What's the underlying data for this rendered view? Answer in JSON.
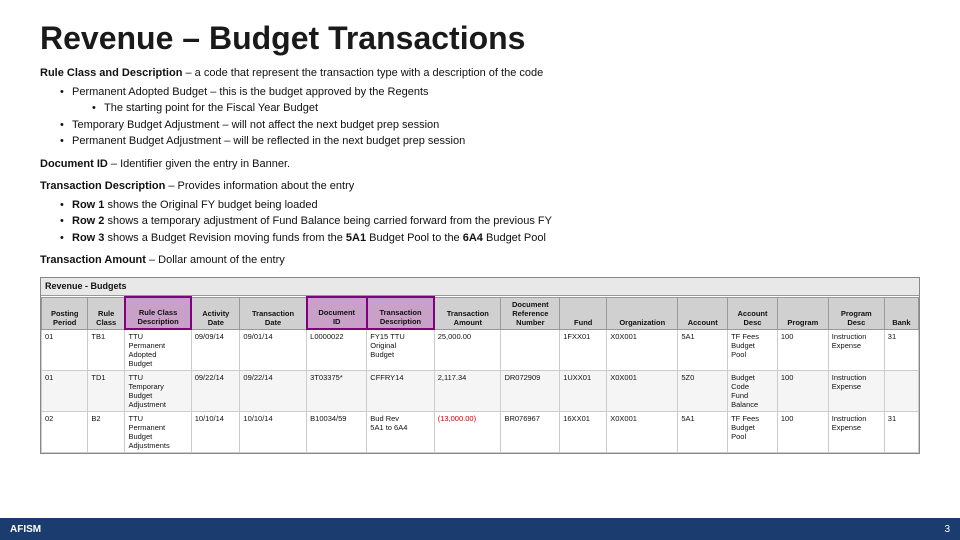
{
  "title": "Revenue – Budget Transactions",
  "sections": [
    {
      "label": "Rule Class and Description",
      "text": " – a code that represent the transaction type with a description of the code",
      "bullets": [
        {
          "text": "Permanent Adopted Budget – this is the budget approved by the Regents",
          "sub": [
            "The starting point for the Fiscal Year Budget"
          ]
        },
        {
          "text": "Temporary Budget Adjustment – will not affect the next budget prep session",
          "sub": []
        },
        {
          "text": "Permanent Budget Adjustment – will be reflected in the next budget prep session",
          "sub": []
        }
      ]
    },
    {
      "label": "Document ID",
      "text": " – Identifier given the entry in Banner."
    },
    {
      "label": "Transaction Description",
      "text": " – Provides information about the entry",
      "bullets": [
        {
          "text": "Row 1 shows the Original FY budget being loaded",
          "bold_word": "Row 1",
          "sub": []
        },
        {
          "text": "Row 2 shows a temporary adjustment of Fund Balance being carried forward from the previous FY",
          "bold_word": "Row 2",
          "sub": []
        },
        {
          "text": "Row 3 shows a Budget Revision moving funds from the 5A1 Budget Pool to the 6A4 Budget Pool",
          "bold_word": "Row 3",
          "sub": []
        }
      ]
    },
    {
      "label": "Transaction Amount",
      "text": " – Dollar amount of the entry"
    }
  ],
  "table": {
    "title": "Revenue - Budgets",
    "headers": [
      "Posting Period",
      "Rule Class",
      "Rule Class Description",
      "Activity Date",
      "Transaction Date",
      "Document ID",
      "Transaction Description",
      "Transaction Amount",
      "Document Reference Number",
      "Fund",
      "Organization",
      "Account",
      "Account Desc",
      "Program",
      "Program Desc",
      "Bank"
    ],
    "rows": [
      {
        "posting_period": "01",
        "rule_class": "TB1",
        "rule_class_desc": "TTU Permanent Adopted Budget",
        "activity_date": "09/09/14",
        "transaction_date": "09/01/14",
        "document_id": "L0000022",
        "transaction_desc": "FY15 TTU Original Budget",
        "transaction_amount": "25,000.00",
        "doc_ref": "",
        "fund": "1FXX01",
        "organization": "X0X001",
        "account": "5A1",
        "account_desc": "TF Fees Budget Pool",
        "program": "100",
        "program_desc": "Instruction Expense",
        "bank": "31"
      },
      {
        "posting_period": "01",
        "rule_class": "TD1",
        "rule_class_desc": "TTU Temporary Budget Adjustment",
        "activity_date": "09/22/14",
        "transaction_date": "09/22/14",
        "document_id": "3T03375",
        "transaction_desc": "CFFRY14",
        "transaction_amount": "2,117.34",
        "doc_ref": "DR072909",
        "fund": "1UXX01",
        "organization": "X0X001",
        "account": "5Z0",
        "account_desc": "Budget Code Fund Balance",
        "program": "100",
        "program_desc": "Instruction Expense",
        "bank": ""
      },
      {
        "posting_period": "02",
        "rule_class": "B2",
        "rule_class_desc": "TTU Permanent Budget Adjustments",
        "activity_date": "10/10/14",
        "transaction_date": "10/10/14",
        "document_id": "B10034/59",
        "transaction_desc": "Bud Rev 5A1 to 6A4",
        "transaction_amount": "(13,000.00)",
        "doc_ref": "BR076967",
        "fund": "16XX01",
        "organization": "X0X001",
        "account": "5A1",
        "account_desc": "TF Fees Budget Pool",
        "program": "100",
        "program_desc": "Instruction Expense",
        "bank": "31"
      }
    ]
  },
  "footer": {
    "left": "AFISM",
    "right": "3"
  }
}
